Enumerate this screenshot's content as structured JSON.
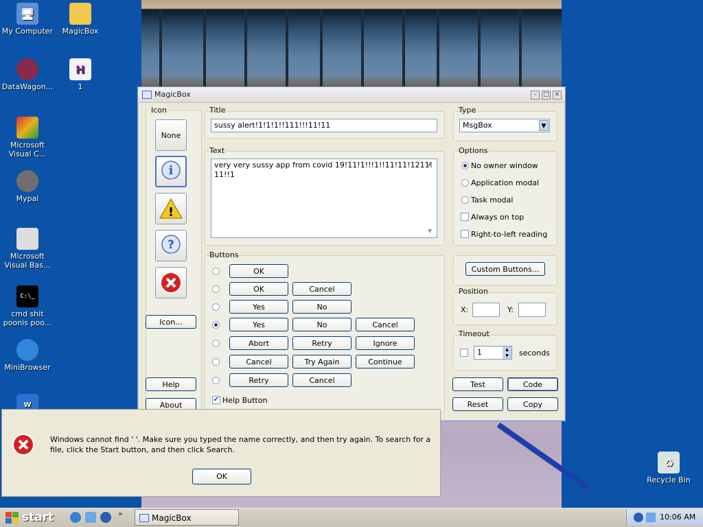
{
  "desktop": {
    "icons": [
      {
        "label": "My Computer"
      },
      {
        "label": "MagicBox"
      },
      {
        "label": "DataWagon..."
      },
      {
        "label": "1"
      },
      {
        "label": "Microsoft Visual C..."
      },
      {
        "label": "Mypal"
      },
      {
        "label": "Microsoft Visual Bas..."
      },
      {
        "label": "cmd shit poonis poo..."
      },
      {
        "label": "MiniBrowser"
      },
      {
        "label": "Recycle Bin"
      }
    ]
  },
  "window": {
    "title": "MagicBox",
    "icon_group": {
      "label": "Icon",
      "none_label": "None",
      "icon_button": "Icon...",
      "help": "Help",
      "about": "About"
    },
    "title_field": {
      "label": "Title",
      "value": "sussy alert!1!1!1!!111!!!11!11"
    },
    "text_field": {
      "label": "Text",
      "value": "very very sussy app from covid 19!11!1!!!1!!11!11!1211!\n11!!1"
    },
    "type": {
      "label": "Type",
      "value": "MsgBox"
    },
    "options": {
      "label": "Options",
      "items": [
        {
          "label": "No owner window",
          "checked": true
        },
        {
          "label": "Application modal",
          "checked": false
        },
        {
          "label": "Task modal",
          "checked": false
        },
        {
          "label": "Always on top",
          "checked": false
        },
        {
          "label": "Right-to-left reading",
          "checked": false
        }
      ]
    },
    "buttons": {
      "label": "Buttons",
      "rows": [
        [
          "OK"
        ],
        [
          "OK",
          "Cancel"
        ],
        [
          "Yes",
          "No"
        ],
        [
          "Yes",
          "No",
          "Cancel"
        ],
        [
          "Abort",
          "Retry",
          "Ignore"
        ],
        [
          "Cancel",
          "Try Again",
          "Continue"
        ],
        [
          "Retry",
          "Cancel"
        ]
      ],
      "selected_row": 3,
      "help_button_label": "Help Button",
      "help_button_checked": true
    },
    "custom_buttons": "Custom Buttons...",
    "position": {
      "label": "Position",
      "x_label": "X:",
      "y_label": "Y:",
      "x_value": "",
      "y_value": ""
    },
    "timeout": {
      "label": "Timeout",
      "value": "1",
      "unit": "seconds",
      "enabled": false
    },
    "actions": {
      "test": "Test",
      "code": "Code",
      "reset": "Reset",
      "copy": "Copy"
    }
  },
  "error_dialog": {
    "message": "Windows cannot find '    '. Make sure you typed the name correctly, and then try again. To search for a file, click the Start button, and then click Search.",
    "ok": "OK"
  },
  "taskbar": {
    "start": "start",
    "task": "MagicBox",
    "clock": "10:06 AM"
  },
  "colors": {
    "desktop": "#0b53a8",
    "error": "#cc2222",
    "info": "#1f5fc7",
    "warning": "#f3c91c"
  }
}
